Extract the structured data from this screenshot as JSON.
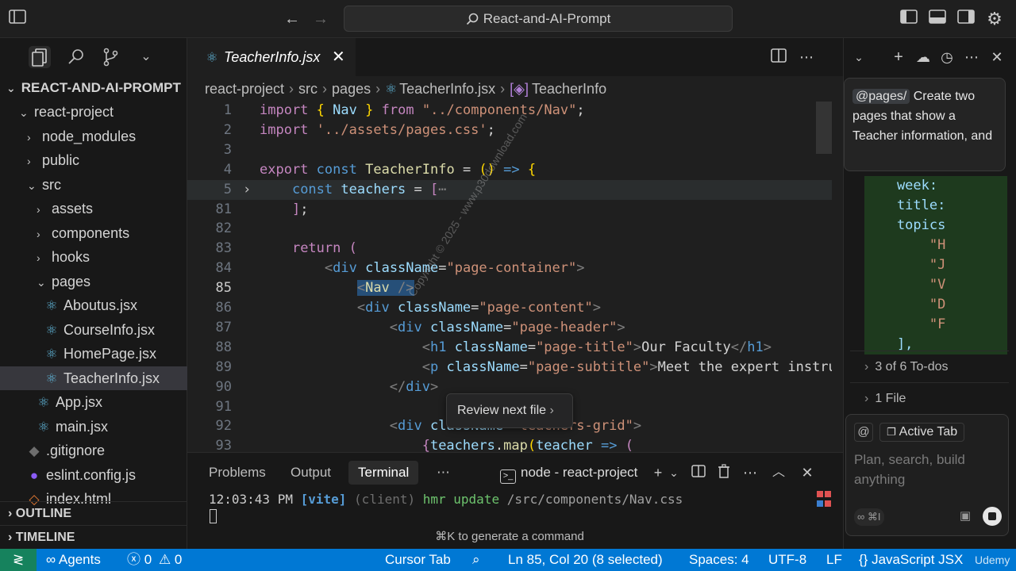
{
  "titlebar": {
    "search_label": "React-and-AI-Prompt"
  },
  "explorer": {
    "root": "REACT-AND-AI-PROMPT",
    "items": [
      {
        "label": "react-project",
        "depth": 1,
        "type": "folder-open"
      },
      {
        "label": "node_modules",
        "depth": 2,
        "type": "folder"
      },
      {
        "label": "public",
        "depth": 2,
        "type": "folder"
      },
      {
        "label": "src",
        "depth": 2,
        "type": "folder-open"
      },
      {
        "label": "assets",
        "depth": 3,
        "type": "folder"
      },
      {
        "label": "components",
        "depth": 3,
        "type": "folder"
      },
      {
        "label": "hooks",
        "depth": 3,
        "type": "folder"
      },
      {
        "label": "pages",
        "depth": 3,
        "type": "folder-open"
      },
      {
        "label": "Aboutus.jsx",
        "depth": 4,
        "type": "react"
      },
      {
        "label": "CourseInfo.jsx",
        "depth": 4,
        "type": "react"
      },
      {
        "label": "HomePage.jsx",
        "depth": 4,
        "type": "react"
      },
      {
        "label": "TeacherInfo.jsx",
        "depth": 4,
        "type": "react",
        "selected": true
      },
      {
        "label": "App.jsx",
        "depth": 3,
        "type": "react"
      },
      {
        "label": "main.jsx",
        "depth": 3,
        "type": "react"
      },
      {
        "label": ".gitignore",
        "depth": 2,
        "type": "git"
      },
      {
        "label": "eslint.config.js",
        "depth": 2,
        "type": "eslint"
      },
      {
        "label": "index.html",
        "depth": 2,
        "type": "html"
      }
    ],
    "outline": "OUTLINE",
    "timeline": "TIMELINE"
  },
  "editor": {
    "tab": "TeacherInfo.jsx",
    "breadcrumb": [
      "react-project",
      "src",
      "pages",
      "TeacherInfo.jsx",
      "TeacherInfo"
    ],
    "current_line": "85",
    "lines": [
      {
        "n": "1",
        "html": "<span class='kw'>import</span> <span class='y'>{</span> <span class='v'>Nav</span> <span class='y'>}</span> <span class='kw'>from</span> <span class='s'>\"../components/Nav\"</span>;"
      },
      {
        "n": "2",
        "html": "<span class='kw'>import</span> <span class='s'>'../assets/pages.css'</span>;"
      },
      {
        "n": "3",
        "html": ""
      },
      {
        "n": "4",
        "html": "<span class='kw'>export</span> <span class='k'>const</span> <span class='f'>TeacherInfo</span> = <span class='y'>()</span> <span class='k'>=&gt;</span> <span class='y'>{</span>"
      },
      {
        "n": "5",
        "html": "    <span class='k'>const</span> <span class='v'>teachers</span> = <span class='kw'>[</span><span class='p'>⋯</span>",
        "fold": true,
        "highlight": true
      },
      {
        "n": "81",
        "html": "    <span class='kw'>]</span>;"
      },
      {
        "n": "82",
        "html": ""
      },
      {
        "n": "83",
        "html": "    <span class='kw'>return</span> <span class='kw'>(</span>"
      },
      {
        "n": "84",
        "html": "        <span class='p'>&lt;</span><span class='t'>div</span> <span class='a'>className</span>=<span class='s'>\"page-container\"</span><span class='p'>&gt;</span>"
      },
      {
        "n": "85",
        "html": "            <span style='background:#264f78'><span class='p'>&lt;</span><span class='f'>Nav</span> <span class='p'>/&gt;</span></span>"
      },
      {
        "n": "86",
        "html": "            <span class='p'>&lt;</span><span class='t'>div</span> <span class='a'>className</span>=<span class='s'>\"page-content\"</span><span class='p'>&gt;</span>"
      },
      {
        "n": "87",
        "html": "                <span class='p'>&lt;</span><span class='t'>div</span> <span class='a'>className</span>=<span class='s'>\"page-header\"</span><span class='p'>&gt;</span>"
      },
      {
        "n": "88",
        "html": "                    <span class='p'>&lt;</span><span class='t'>h1</span> <span class='a'>className</span>=<span class='s'>\"page-title\"</span><span class='p'>&gt;</span>Our Faculty<span class='p'>&lt;/</span><span class='t'>h1</span><span class='p'>&gt;</span>"
      },
      {
        "n": "89",
        "html": "                    <span class='p'>&lt;</span><span class='t'>p</span> <span class='a'>className</span>=<span class='s'>\"page-subtitle\"</span><span class='p'>&gt;</span>Meet the expert instruc"
      },
      {
        "n": "90",
        "html": "                <span class='p'>&lt;/</span><span class='t'>div</span><span class='p'>&gt;</span>"
      },
      {
        "n": "91",
        "html": ""
      },
      {
        "n": "92",
        "html": "                <span class='p'>&lt;</span><span class='t'>div</span> <span class='a'>className</span>=<span class='s'>\"teachers-grid\"</span><span class='p'>&gt;</span>"
      },
      {
        "n": "93",
        "html": "                    <span class='kw'>{</span><span class='v'>teachers</span>.<span class='f'>map</span><span class='y'>(</span><span class='v'>teacher</span> <span class='k'>=&gt;</span> <span class='kw'>(</span>"
      }
    ],
    "review_popup": "Review next file",
    "watermark": "Copyright © 2025 - www.p30download.com"
  },
  "panel": {
    "tabs": [
      "Problems",
      "Output",
      "Terminal"
    ],
    "active_tab": "Terminal",
    "terminal_name": "node - react-project",
    "log_time": "12:03:43 PM",
    "log_tag": "[vite]",
    "log_client": "(client)",
    "log_msg": "hmr update",
    "log_path": "/src/components/Nav.css",
    "hint": "⌘K to generate a command"
  },
  "chat": {
    "mention": "@pages/",
    "prompt_text": "Create two pages that show a Teacher information, and",
    "diff_lines": [
      "    week:",
      "    title:",
      "    topics",
      "        \"H",
      "        \"J",
      "        \"V",
      "        \"D",
      "        \"F",
      "    ],"
    ],
    "todos": "3 of 6 To-dos",
    "files": "1 File",
    "context_chip": "Active Tab",
    "composer_placeholder": "Plan, search, build anything",
    "mode_label": "∞ ⌘I"
  },
  "statusbar": {
    "agents": "Agents",
    "errors": "0",
    "warnings": "0",
    "cursor_tab": "Cursor Tab",
    "position": "Ln 85, Col 20 (8 selected)",
    "spaces": "Spaces: 4",
    "encoding": "UTF-8",
    "eol": "LF",
    "language": "JavaScript JSX",
    "brand": "Udemy"
  }
}
